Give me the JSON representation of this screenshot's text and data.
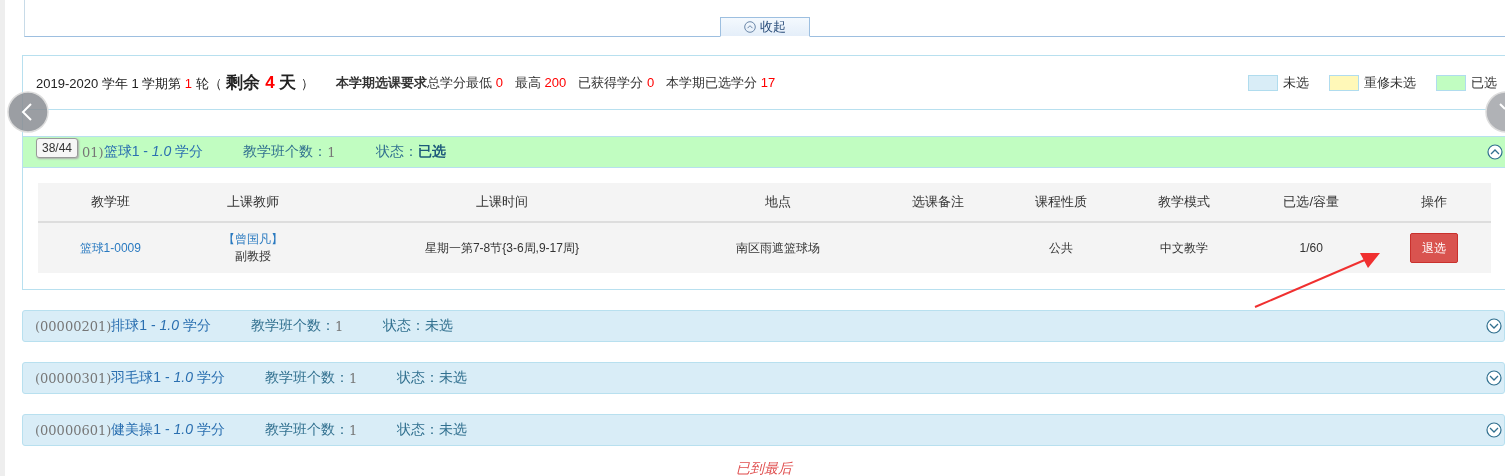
{
  "collapse_tab": {
    "label": "收起"
  },
  "summary": {
    "term_prefix": "2019-2020 学年 1 学期第",
    "round": "1",
    "round_unit": "轮（",
    "remain_label": "剩余",
    "remain_days": "4",
    "remain_unit": "天",
    "close": "）",
    "requirement_title": "本学期选课要求",
    "requirements": [
      {
        "label": "总学分最低",
        "value": "0"
      },
      {
        "label": "最高",
        "value": "200"
      },
      {
        "label": "已获得学分",
        "value": "0"
      },
      {
        "label": "本学期已选学分",
        "value": "17"
      }
    ]
  },
  "legend": [
    {
      "label": "未选",
      "color": "#d9edf7"
    },
    {
      "label": "重修未选",
      "color": "#fff8b8"
    },
    {
      "label": "已选",
      "color": "#c1fdc1"
    }
  ],
  "pager_tooltip": "38/44",
  "courses": [
    {
      "code": "01)",
      "title": "篮球1 - *1.0* 学分",
      "count_label": "教学班个数：",
      "count": "1",
      "status_label": "状态：",
      "status": "已选",
      "selected": true,
      "expanded": true,
      "table": {
        "columns": [
          "教学班",
          "上课教师",
          "上课时间",
          "地点",
          "选课备注",
          "课程性质",
          "教学模式",
          "已选/容量",
          "操作"
        ],
        "rows": [
          {
            "class": "篮球1-0009",
            "teacher": "【曾国凡】",
            "teacher_title": "副教授",
            "time": "星期一第7-8节{3-6周,9-17周}",
            "place": "南区雨遮篮球场",
            "note": "",
            "nature": "公共",
            "mode": "中文教学",
            "enrolled": "1/60",
            "action": "退选"
          }
        ]
      }
    },
    {
      "code": "(00000201)",
      "title": "排球1 - *1.0* 学分",
      "count_label": "教学班个数：",
      "count": "1",
      "status_label": "状态：",
      "status": "未选",
      "selected": false,
      "expanded": false
    },
    {
      "code": "(00000301)",
      "title": "羽毛球1 - *1.0* 学分",
      "count_label": "教学班个数：",
      "count": "1",
      "status_label": "状态：",
      "status": "未选",
      "selected": false,
      "expanded": false
    },
    {
      "code": "(00000601)",
      "title": "健美操1 - *1.0* 学分",
      "count_label": "教学班个数：",
      "count": "1",
      "status_label": "状态：",
      "status": "未选",
      "selected": false,
      "expanded": false
    }
  ],
  "footer": "已到最后"
}
